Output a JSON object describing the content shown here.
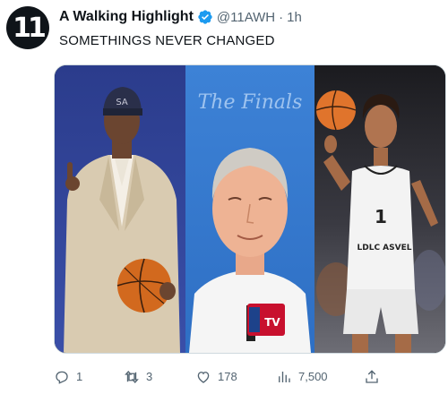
{
  "tweet": {
    "author_name": "A Walking Highlight",
    "handle": "@11AWH",
    "separator": "·",
    "time": "1h",
    "text": "SOMETHINGS NEVER CHANGED",
    "avatar_glyph": "11",
    "verified_color": "#1d9bf0"
  },
  "media": {
    "panels": [
      {
        "name": "player-draft-photo",
        "description": ""
      },
      {
        "name": "coach-portrait",
        "logo_text": "The Finals",
        "badge_text": "TV"
      },
      {
        "name": "young-player-photo",
        "jersey_number": "1",
        "sponsor_text": "LDLC ASVEL"
      }
    ]
  },
  "actions": {
    "reply": {
      "icon": "reply-icon",
      "count": "1"
    },
    "retweet": {
      "icon": "retweet-icon",
      "count": "3"
    },
    "like": {
      "icon": "heart-icon",
      "count": "178"
    },
    "views": {
      "icon": "views-icon",
      "count": "7,500"
    },
    "share": {
      "icon": "share-icon"
    }
  }
}
